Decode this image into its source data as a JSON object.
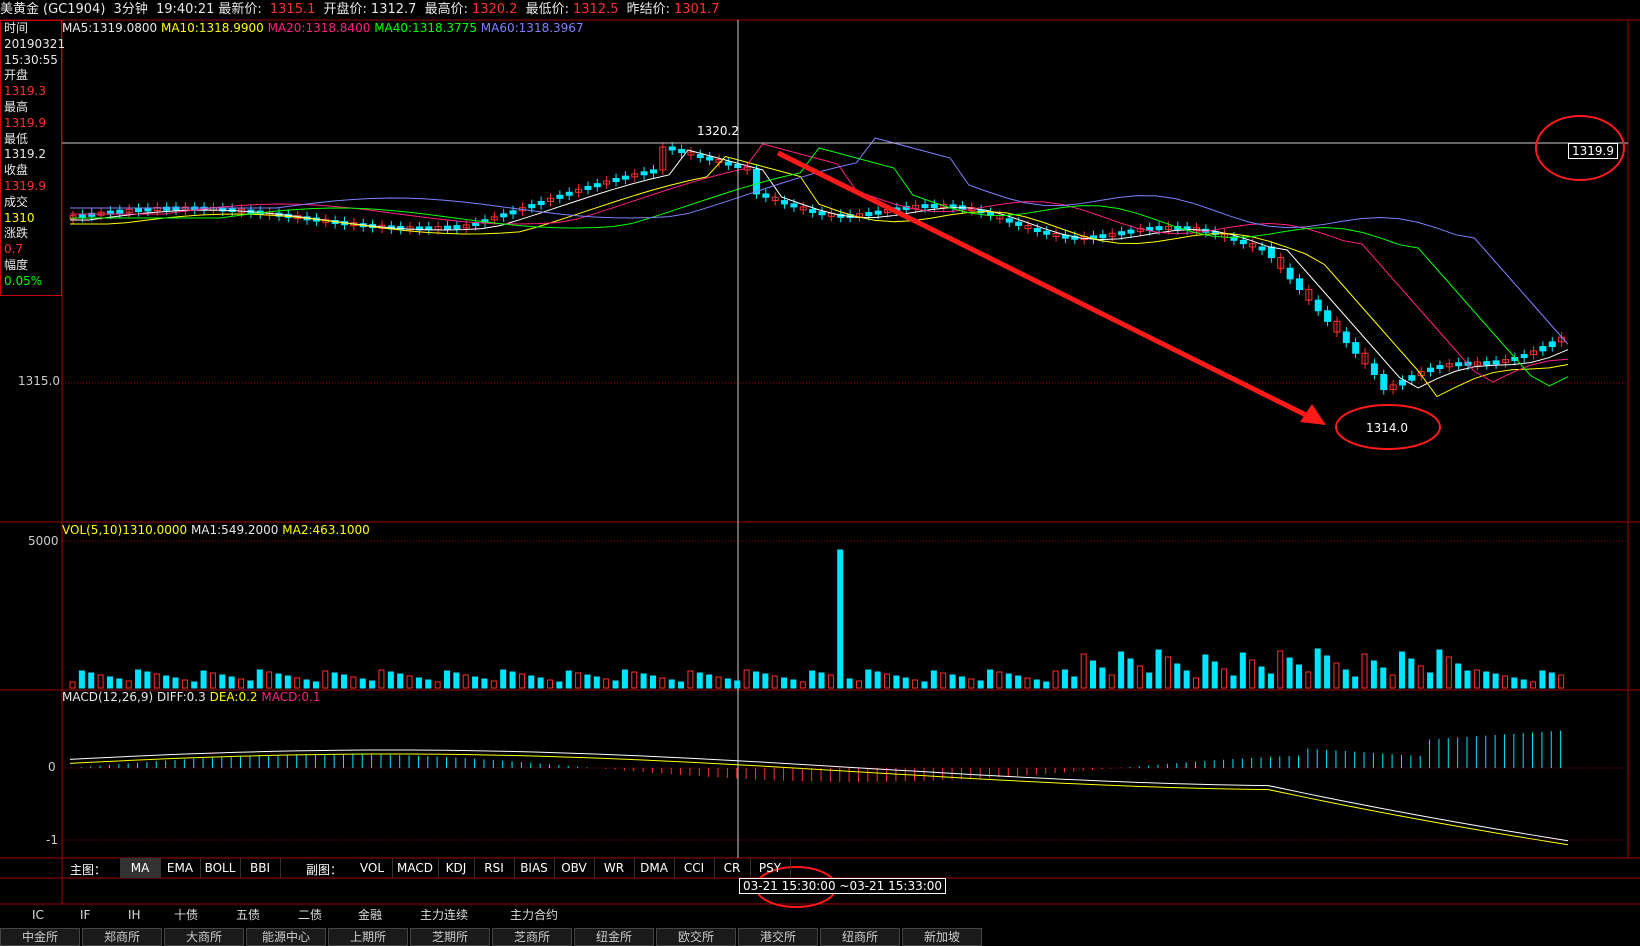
{
  "header": {
    "instrument": "美黄金",
    "code": "(GC1904)",
    "period": "3分钟",
    "time": "19:40:21",
    "latest_label": "最新价:",
    "latest": "1315.1",
    "open_label": "开盘价:",
    "open": "1312.7",
    "high_label": "最高价:",
    "high": "1320.2",
    "low_label": "最低价:",
    "low": "1312.5",
    "prev_label": "昨结价:",
    "prev": "1301.7"
  },
  "info": {
    "time_label": "时间",
    "date": "20190321",
    "clock": "15:30:55",
    "open_label": "开盘",
    "open": "1319.3",
    "high_label": "最高",
    "high": "1319.9",
    "low_label": "最低",
    "low": "1319.2",
    "close_label": "收盘",
    "close": "1319.9",
    "vol_label": "成交",
    "vol": "1310",
    "chg_label": "涨跌",
    "chg": "0.7",
    "amp_label": "幅度",
    "amp": "0.05%"
  },
  "ma_legend": {
    "ma5": "MA5:1319.0800",
    "ma10": "MA10:1318.9900",
    "ma20": "MA20:1318.8400",
    "ma40": "MA40:1318.3775",
    "ma60": "MA60:1318.3967"
  },
  "price_axis": {
    "level": "1315.0"
  },
  "annotations": {
    "high_marker": "1320.2",
    "low_marker": "1314.0",
    "cursor_price": "1319.9"
  },
  "vol_legend": {
    "vol": "VOL(5,10)1310.0000",
    "ma1": "MA1:549.2000",
    "ma2": "MA2:463.1000",
    "axis": "5000"
  },
  "macd_legend": {
    "title": "MACD(12,26,9)",
    "diff": "DIFF:0.3",
    "dea": "DEA:0.2",
    "macd": "MACD:0.1",
    "axis_zero": "0",
    "axis_neg": "-1"
  },
  "toolbar": {
    "main_label": "主图：",
    "main": [
      "MA",
      "EMA",
      "BOLL",
      "BBI"
    ],
    "sub_label": "副图：",
    "sub": [
      "VOL",
      "MACD",
      "KDJ",
      "RSI",
      "BIAS",
      "OBV",
      "WR",
      "DMA",
      "CCI",
      "CR",
      "PSY"
    ]
  },
  "time_range": "03-21 15:30:00 ~03-21 15:33:00",
  "categories": [
    "IC",
    "IF",
    "IH",
    "十债",
    "五债",
    "二债",
    "金融",
    "主力连续",
    "主力合约"
  ],
  "exchanges": [
    "中金所",
    "郑商所",
    "大商所",
    "能源中心",
    "上期所",
    "芝期所",
    "芝商所",
    "纽金所",
    "欧交所",
    "港交所",
    "纽商所",
    "新加坡"
  ],
  "colors": {
    "up": "#ff3030",
    "down": "#00e5ff",
    "grid": "#a00000",
    "ma5": "#ffffff",
    "ma10": "#ffff00",
    "ma20": "#ff2080",
    "ma40": "#00ff00",
    "ma60": "#8080ff",
    "arrow": "#ff1a1a"
  }
}
